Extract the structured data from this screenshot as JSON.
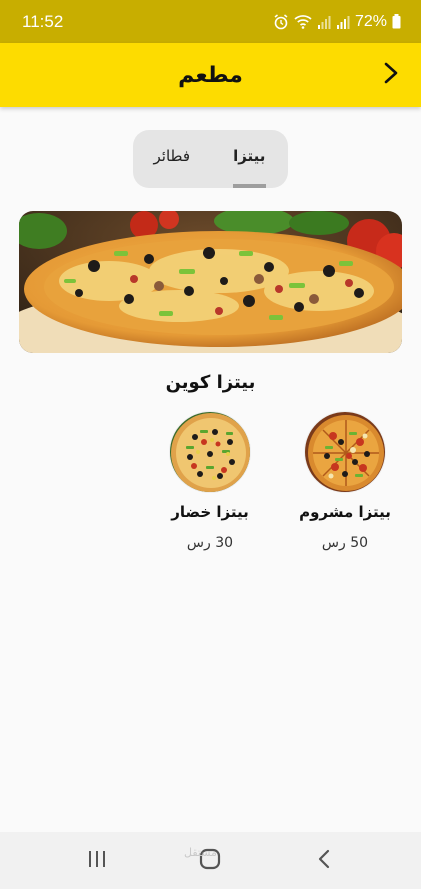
{
  "status_bar": {
    "time": "11:52",
    "battery": "72%",
    "icons": [
      "alarm-icon",
      "wifi-icon",
      "signal-icon",
      "signal-icon",
      "battery-icon"
    ]
  },
  "app_bar": {
    "title": "مطعم",
    "back_icon": "chevron-right-icon"
  },
  "tabs": [
    {
      "label": "بيتزا",
      "active": true
    },
    {
      "label": "فطائر",
      "active": false
    }
  ],
  "banner": {
    "image": "pizza-banner-image"
  },
  "section": {
    "title": "بيتزا كوين",
    "products": [
      {
        "name": "بيتزا مشروم",
        "price": "50 رس",
        "image": "pizza-mushroom-image"
      },
      {
        "name": "بيتزا خضار",
        "price": "30 رس",
        "image": "pizza-vegetable-image"
      }
    ]
  },
  "nav_bar": {
    "icons": [
      "recent-apps-icon",
      "home-icon",
      "back-icon"
    ]
  },
  "watermark": "مستقل",
  "colors": {
    "status_bar": "#c8ae00",
    "app_bar": "#fddc00",
    "background": "#fafafa",
    "tab_bg": "#e5e5e5",
    "tab_indicator": "#9e9e9e"
  }
}
